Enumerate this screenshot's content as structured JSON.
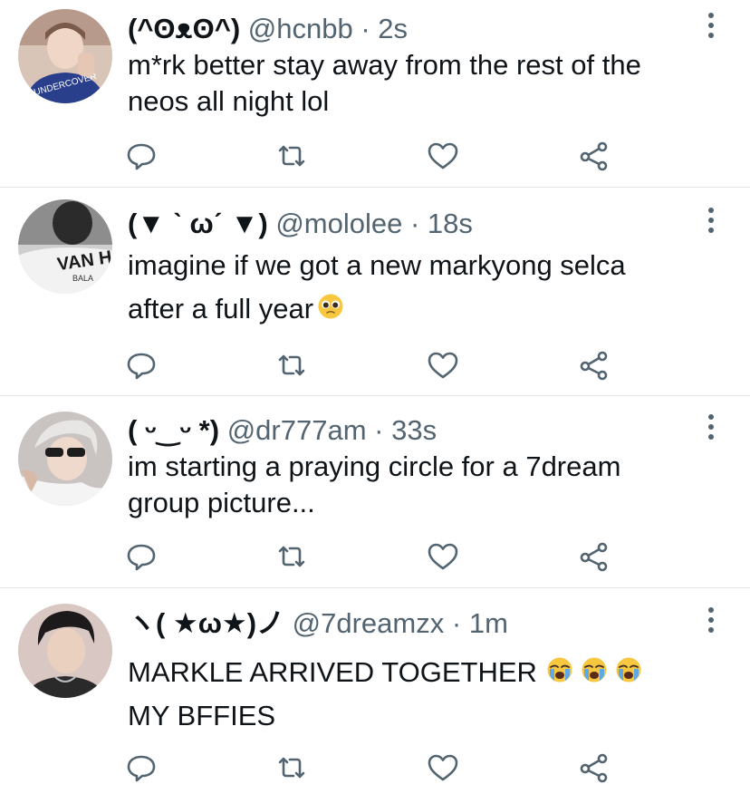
{
  "tweets": [
    {
      "display_name": "(^ʘᴥʘ^)",
      "handle": "@hcnbb",
      "separator": "·",
      "time": "2s",
      "text_lines": [
        "m*rk better stay away from the rest of the",
        "neos all night lol"
      ],
      "avatar_icon": "avatar-photo"
    },
    {
      "display_name": "(▼ ˋ ωˊ ▼)",
      "handle": "@mololee",
      "separator": "·",
      "time": "18s",
      "text_lines": [
        "imagine if we got a new markyong selca",
        "after a full year"
      ],
      "emoji": [
        "pleading-face-emoji"
      ],
      "avatar_icon": "avatar-photo"
    },
    {
      "display_name": "( ᵕ‿ᵕ *)",
      "handle": "@dr777am",
      "separator": "·",
      "time": "33s",
      "text_lines": [
        "im starting a praying circle for a 7dream",
        "group picture..."
      ],
      "avatar_icon": "avatar-photo"
    },
    {
      "display_name": "ヽ( ★ω★)ノ",
      "handle": "@7dreamzx",
      "separator": "·",
      "time": "1m",
      "text_lines": [
        "MARKLE ARRIVED TOGETHER",
        "MY BFFIES"
      ],
      "emoji": [
        "loudly-crying-face-emoji",
        "loudly-crying-face-emoji",
        "loudly-crying-face-emoji"
      ],
      "avatar_icon": "avatar-photo"
    }
  ],
  "actions": [
    "reply-icon",
    "retweet-icon",
    "like-icon",
    "share-icon"
  ],
  "colors": {
    "text": "#0f1419",
    "secondary": "#536471",
    "divider": "#e6e6e6",
    "emoji_yellow": "#f7c740",
    "emoji_blue": "#5fa8e6"
  }
}
